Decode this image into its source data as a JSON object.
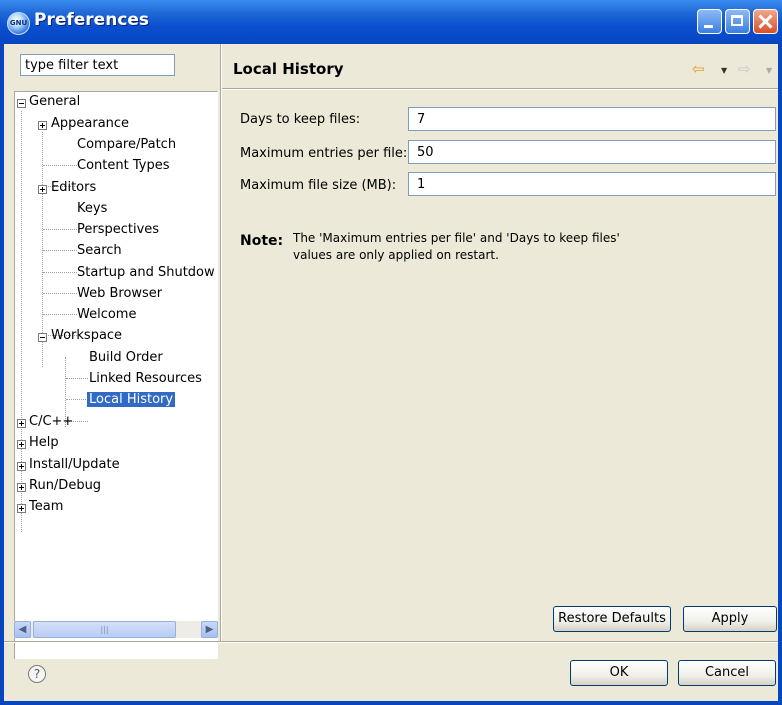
{
  "window": {
    "title": "Preferences"
  },
  "filter": {
    "placeholder": "type filter text",
    "value": "type filter text"
  },
  "tree": {
    "general": "General",
    "appearance": "Appearance",
    "compare": "Compare/Patch",
    "content_types": "Content Types",
    "editors": "Editors",
    "keys": "Keys",
    "perspectives": "Perspectives",
    "search": "Search",
    "startup": "Startup and Shutdow",
    "web_browser": "Web Browser",
    "welcome": "Welcome",
    "workspace": "Workspace",
    "build_order": "Build Order",
    "linked_resources": "Linked Resources",
    "local_history": "Local History",
    "cpp": "C/C++",
    "help": "Help",
    "install": "Install/Update",
    "run_debug": "Run/Debug",
    "team": "Team"
  },
  "page": {
    "title": "Local History",
    "days_label": "Days to keep files:",
    "days_value": "7",
    "entries_label": "Maximum entries per file:",
    "entries_value": "50",
    "size_label": "Maximum file size (MB):",
    "size_value": "1",
    "note_label": "Note:",
    "note_line1": "The 'Maximum entries per file' and 'Days to keep files'",
    "note_line2": "values are only applied on restart."
  },
  "buttons": {
    "restore_defaults": "Restore Defaults",
    "apply": "Apply",
    "ok": "OK",
    "cancel": "Cancel"
  },
  "icons": {
    "app": "eclipse-icon",
    "help": "help-icon",
    "back": "back-arrow-icon",
    "forward": "forward-arrow-icon"
  }
}
